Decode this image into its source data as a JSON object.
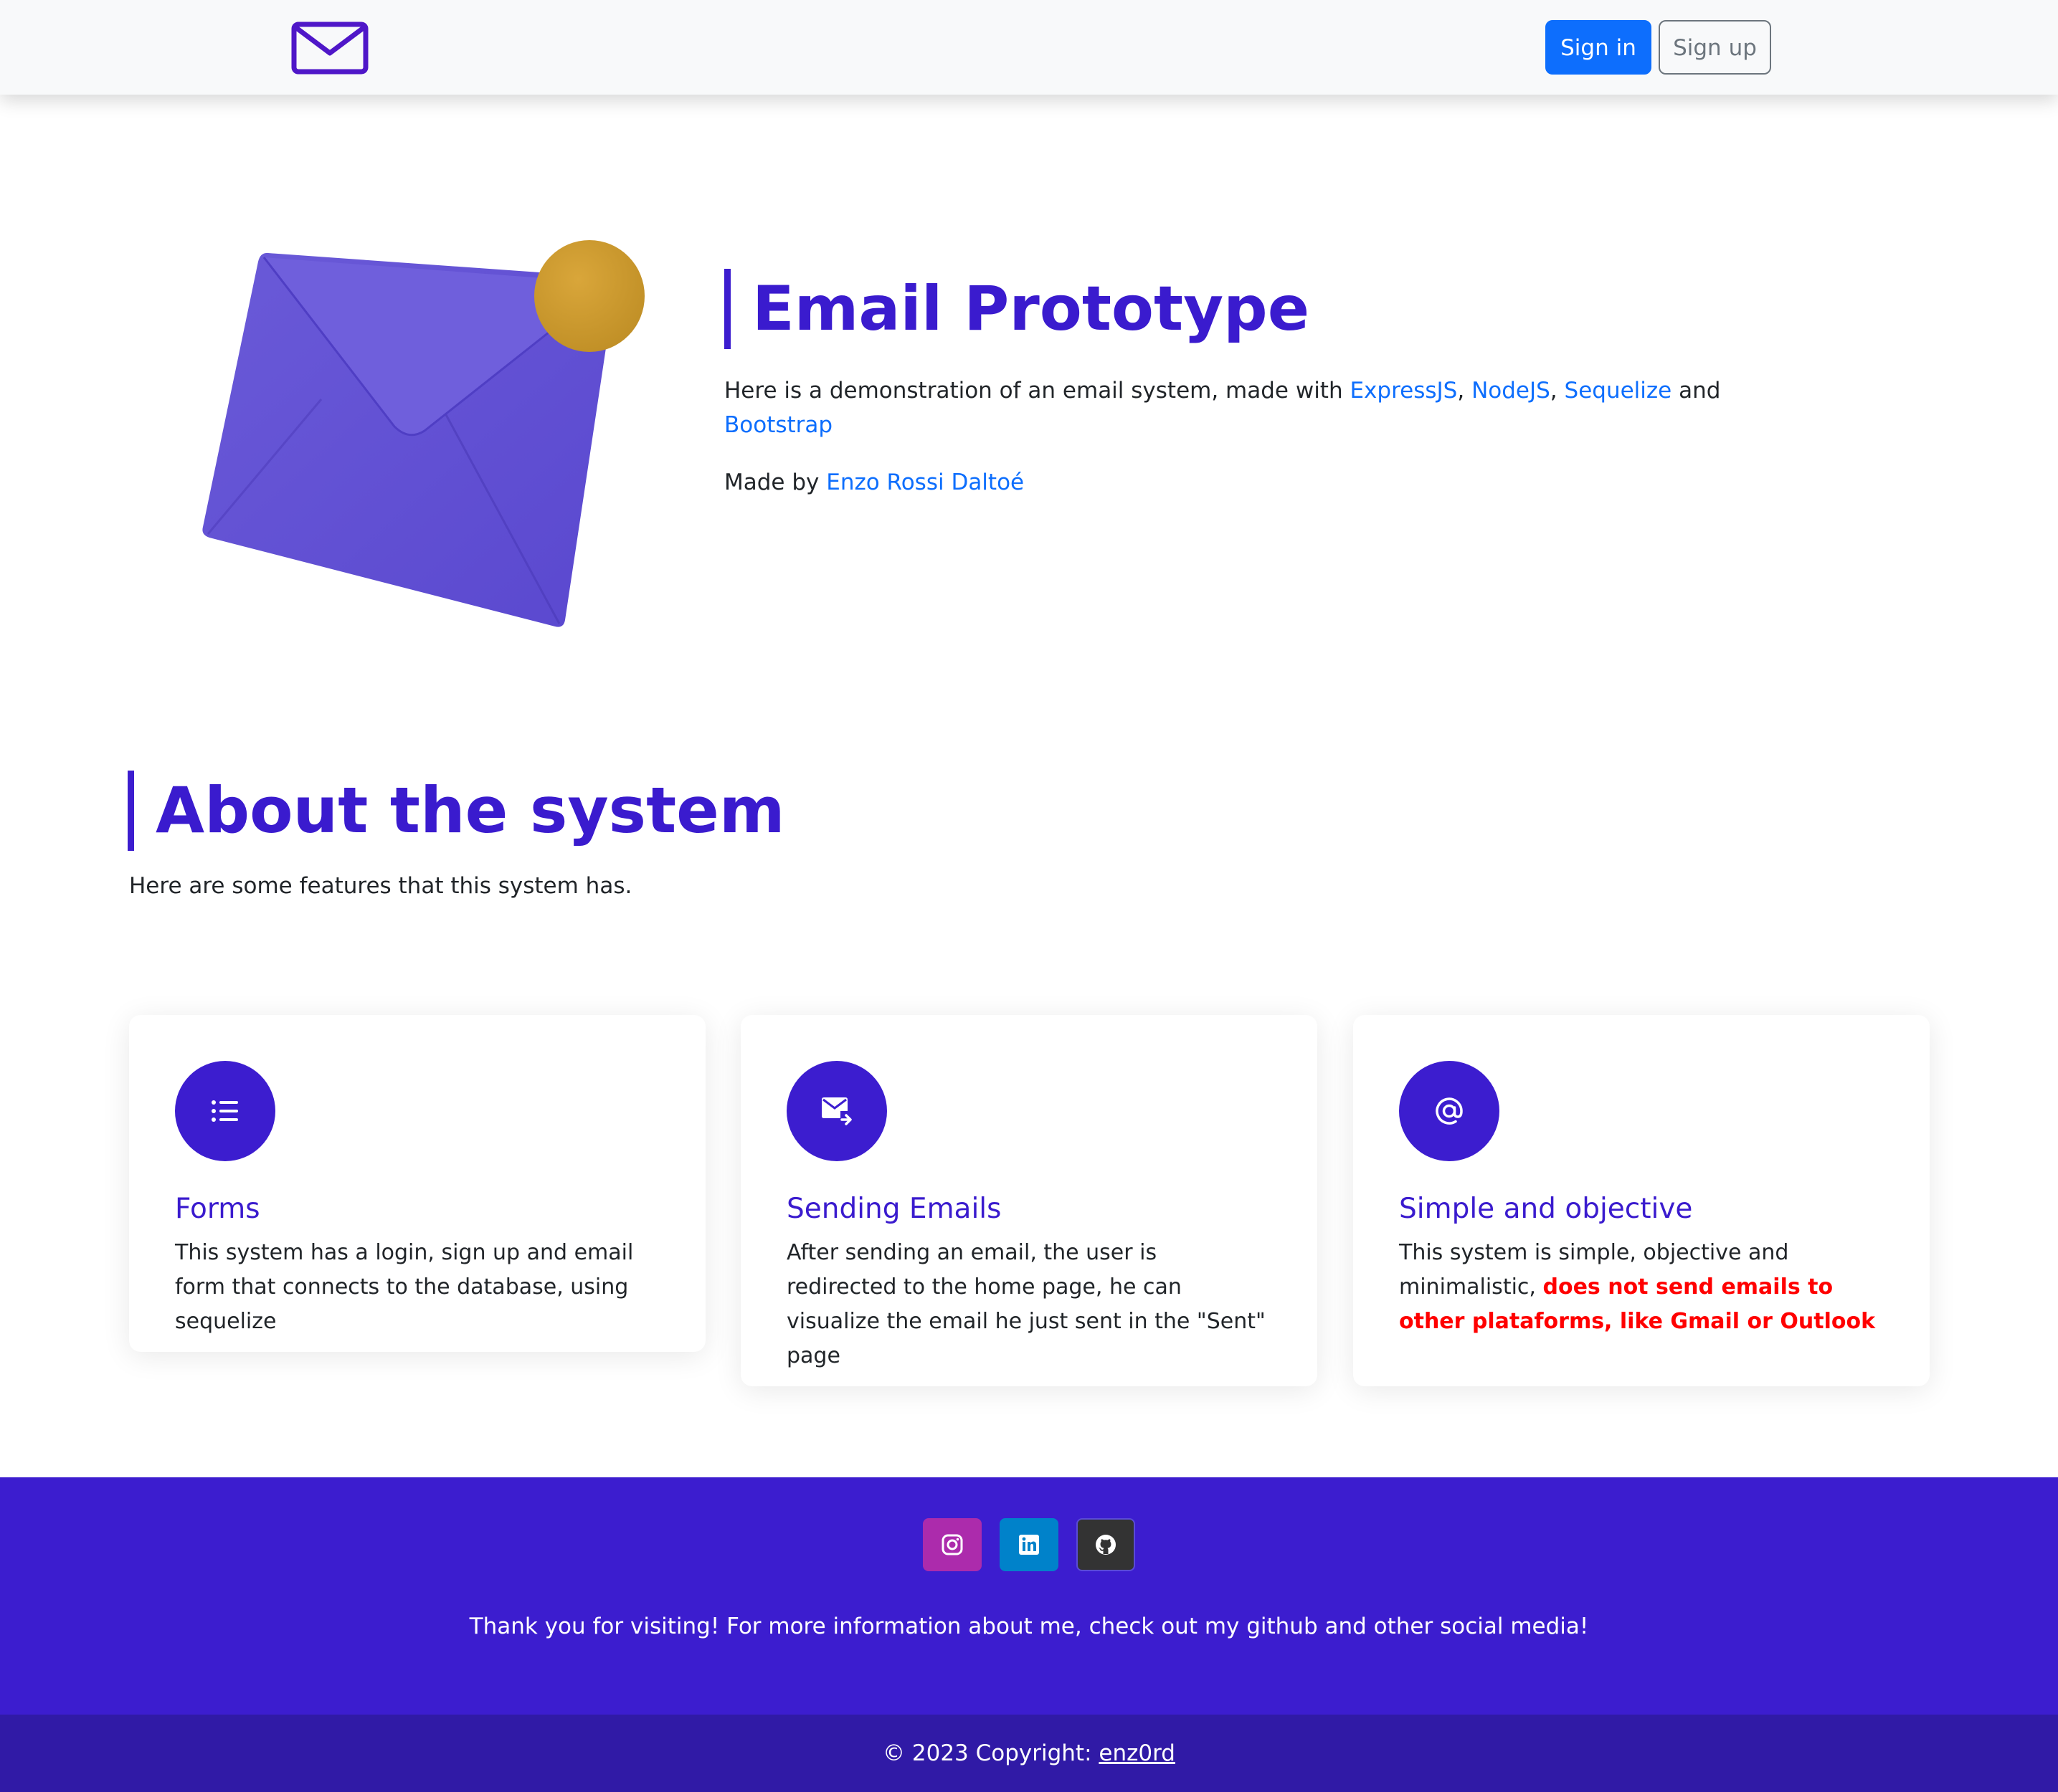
{
  "navbar": {
    "logo_icon": "envelope-icon",
    "sign_in_label": "Sign in",
    "sign_up_label": "Sign up"
  },
  "hero": {
    "illustration": "envelope-notification-illustration",
    "title": "Email Prototype",
    "description_prefix": "Here is a demonstration of an email system, made with ",
    "tech_links": [
      "ExpressJS",
      "NodeJS",
      "Sequelize",
      "Bootstrap"
    ],
    "sep_comma": ", ",
    "sep_and": " and ",
    "made_by_prefix": "Made by ",
    "author": "Enzo Rossi Daltoé"
  },
  "about": {
    "title": "About the system",
    "subtitle": "Here are some features that this system has."
  },
  "cards": [
    {
      "icon": "list-icon",
      "title": "Forms",
      "text": "This system has a login, sign up and email form that connects to the database, using sequelize"
    },
    {
      "icon": "envelope-forward-icon",
      "title": "Sending Emails",
      "text": "After sending an email, the user is redirected to the home page, he can visualize the email he just sent in the \"Sent\" page"
    },
    {
      "icon": "at-icon",
      "title": "Simple and objective",
      "text": "This system is simple, objective and minimalistic, ",
      "warning": "does not send emails to other plataforms, like Gmail or Outlook"
    }
  ],
  "footer": {
    "social": [
      "instagram-icon",
      "linkedin-icon",
      "github-icon"
    ],
    "message": "Thank you for visiting! For more information about me, check out my github and other social media!",
    "copyright_prefix": "© 2023 Copyright: ",
    "copyright_link": "enz0rd"
  },
  "colors": {
    "brand": "#3c1dcf",
    "primary_button": "#0d6efd",
    "secondary_button": "#6c757d",
    "link": "#0d6efd",
    "warning": "#ff0000",
    "footer_bottom": "#301aa6",
    "notification_dot": "#d4a02e"
  }
}
